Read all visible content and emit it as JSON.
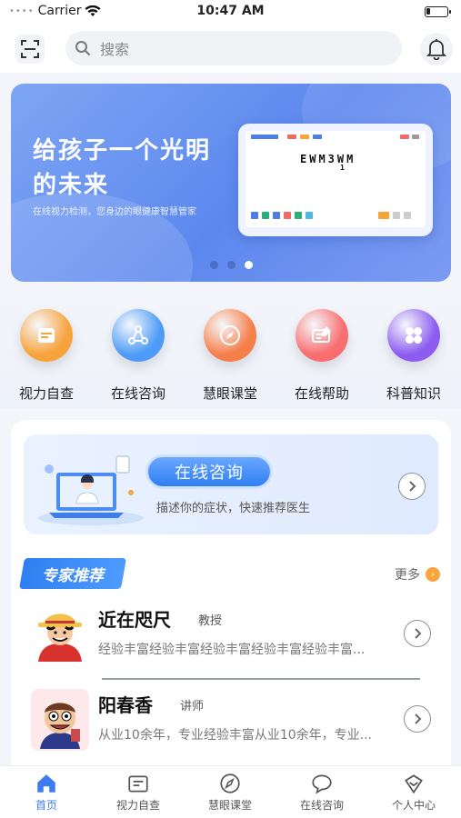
{
  "status_bar": {
    "carrier": "Carrier",
    "time": "10:47 AM",
    "battery_level": 0.2
  },
  "header": {
    "search_placeholder": "搜索"
  },
  "banner": {
    "title": "给孩子一个光明的未来",
    "subtitle": "在线视力检测，您身边的眼健康智慧管家",
    "chart_line1": "EWM3WM",
    "chart_line2": "1",
    "slide_count": 3,
    "active_slide": 3
  },
  "quick_menu": [
    {
      "label": "视力自查",
      "icon": "vision-check-icon",
      "color": "#f7a33c"
    },
    {
      "label": "在线咨询",
      "icon": "network-icon",
      "color": "#4e9bf7"
    },
    {
      "label": "慧眼课堂",
      "icon": "compass-icon",
      "color": "#f57f4b"
    },
    {
      "label": "在线帮助",
      "icon": "edit-card-icon",
      "color": "#f86d6d"
    },
    {
      "label": "科普知识",
      "icon": "clover-icon",
      "color": "#8c5cf0"
    }
  ],
  "consult_card": {
    "button_label": "在线咨询",
    "description": "描述你的症状，快速推荐医生"
  },
  "experts": {
    "section_title": "专家推荐",
    "more_label": "更多",
    "items": [
      {
        "name": "近在咫尺",
        "title": "教授",
        "description": "经验丰富经验丰富经验丰富经验丰富经验丰富..."
      },
      {
        "name": "阳春香",
        "title": "讲师",
        "description": "从业10余年，专业经验丰富从业10余年，专业..."
      }
    ]
  },
  "tabbar": [
    {
      "label": "首页",
      "icon": "home-icon",
      "active": true
    },
    {
      "label": "视力自查",
      "icon": "vision-card-icon",
      "active": false
    },
    {
      "label": "慧眼课堂",
      "icon": "compass-icon",
      "active": false
    },
    {
      "label": "在线咨询",
      "icon": "chat-bubble-icon",
      "active": false
    },
    {
      "label": "个人中心",
      "icon": "profile-icon",
      "active": false
    }
  ]
}
